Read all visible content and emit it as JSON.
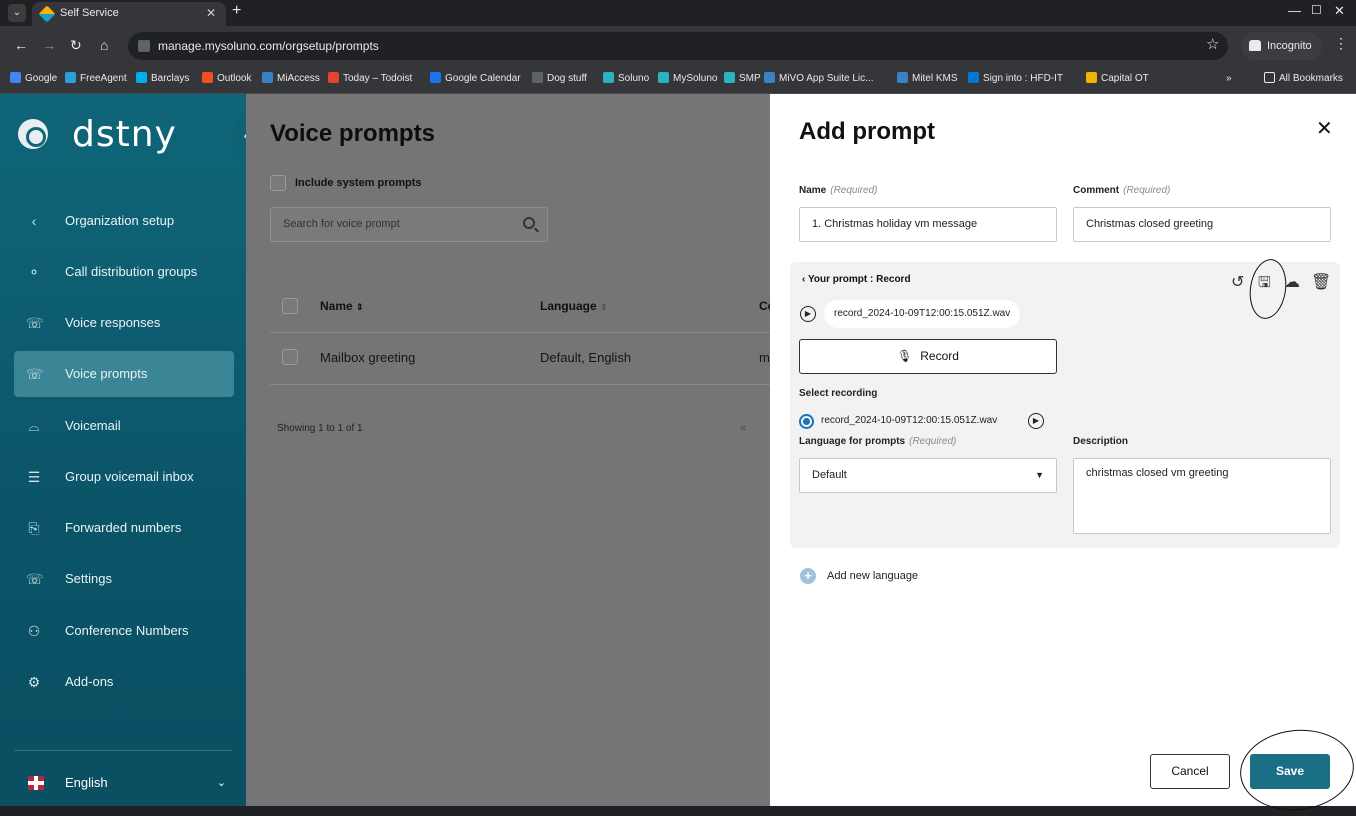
{
  "browser": {
    "tab_title": "Self Service",
    "url": "manage.mysoluno.com/orgsetup/prompts",
    "incognito_label": "Incognito",
    "bookmarks": [
      {
        "label": "Google",
        "color": "#4285f4"
      },
      {
        "label": "FreeAgent",
        "color": "#2a9fd8"
      },
      {
        "label": "Barclays",
        "color": "#00aeef"
      },
      {
        "label": "Outlook",
        "color": "#f25022"
      },
      {
        "label": "MiAccess",
        "color": "#3b82c4"
      },
      {
        "label": "Today – Todoist",
        "color": "#e44332"
      },
      {
        "label": "Google Calendar",
        "color": "#1a73e8"
      },
      {
        "label": "Dog stuff",
        "color": "#5f6368"
      },
      {
        "label": "Soluno",
        "color": "#2bb3c0"
      },
      {
        "label": "MySoluno",
        "color": "#2bb3c0"
      },
      {
        "label": "SMP",
        "color": "#2bb3c0"
      },
      {
        "label": "MiVO App Suite Lic...",
        "color": "#3b82c4"
      },
      {
        "label": "Mitel KMS",
        "color": "#3b82c4"
      },
      {
        "label": "Sign into : HFD-IT",
        "color": "#0078d4"
      },
      {
        "label": "Capital OT",
        "color": "#f0b400"
      }
    ],
    "overflow_label": "»",
    "all_bookmarks_label": "All Bookmarks"
  },
  "sidebar": {
    "logo_text": "dstny",
    "items": [
      {
        "label": "Organization setup",
        "icon": "chevron-left-icon",
        "glyph": "‹"
      },
      {
        "label": "Call distribution groups",
        "icon": "flow-icon",
        "glyph": "⚬"
      },
      {
        "label": "Voice responses",
        "icon": "phone-waves-icon",
        "glyph": "☏"
      },
      {
        "label": "Voice prompts",
        "icon": "phone-prompt-icon",
        "glyph": "☏"
      },
      {
        "label": "Voicemail",
        "icon": "voicemail-icon",
        "glyph": "⌓"
      },
      {
        "label": "Group voicemail inbox",
        "icon": "inbox-icon",
        "glyph": "☰"
      },
      {
        "label": "Forwarded numbers",
        "icon": "forward-icon",
        "glyph": "⎘"
      },
      {
        "label": "Settings",
        "icon": "phone-settings-icon",
        "glyph": "☏"
      },
      {
        "label": "Conference Numbers",
        "icon": "conference-icon",
        "glyph": "⚇"
      },
      {
        "label": "Add-ons",
        "icon": "addons-icon",
        "glyph": "⚙"
      }
    ],
    "language_label": "English"
  },
  "main": {
    "title": "Voice prompts",
    "include_system_prompts": "Include system prompts",
    "search_placeholder": "Search for voice prompt",
    "columns": [
      "Name",
      "Language",
      "Co"
    ],
    "rows": [
      {
        "name": "Mailbox greeting",
        "language": "Default, English",
        "comment": "m"
      }
    ],
    "showing": "Showing 1 to 1 of 1",
    "pager_first": "«"
  },
  "panel": {
    "title": "Add prompt",
    "name_label": "Name",
    "required": "(Required)",
    "name_value": "1. Christmas holiday vm message",
    "comment_label": "Comment",
    "comment_value": "Christmas closed greeting",
    "your_prompt": "Your prompt : Record",
    "file_name": "record_2024-10-09T12:00:15.051Z.wav",
    "record_label": "Record",
    "select_recording": "Select recording",
    "recording_option": "record_2024-10-09T12:00:15.051Z.wav",
    "language_label": "Language for prompts",
    "language_value": "Default",
    "description_label": "Description",
    "description_value": "christmas closed vm greeting",
    "add_language": "Add new language",
    "cancel_label": "Cancel",
    "save_label": "Save"
  }
}
